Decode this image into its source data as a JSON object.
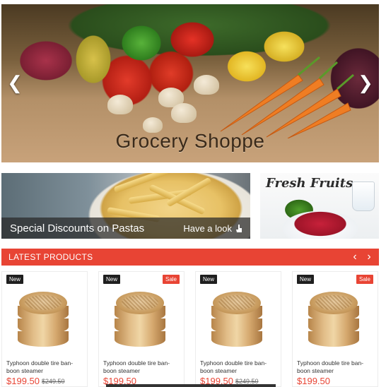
{
  "hero": {
    "title": "Grocery Shoppe",
    "prev_icon": "chevron-left-icon",
    "next_icon": "chevron-right-icon"
  },
  "banners": {
    "pasta": {
      "caption": "Special Discounts on Pastas",
      "link_label": "Have a look",
      "link_icon": "cursor-icon"
    },
    "fruits": {
      "title": "Fresh Fruits"
    }
  },
  "latest": {
    "label": "LATEST PRODUCTS",
    "prev_icon": "chevron-left-icon",
    "next_icon": "chevron-right-icon"
  },
  "products": [
    {
      "badge_new": "New",
      "badge_sale": "",
      "name": "Typhoon double tire ban-boon steamer",
      "price": "$199.50",
      "old_price": "$249.50"
    },
    {
      "badge_new": "New",
      "badge_sale": "Sale",
      "name": "Typhoon double tire ban-boon steamer",
      "price": "$199.50",
      "old_price": ""
    },
    {
      "badge_new": "New",
      "badge_sale": "",
      "name": "Typhoon double tire ban-boon steamer",
      "price": "$199.50",
      "old_price": "$249.50"
    },
    {
      "badge_new": "New",
      "badge_sale": "Sale",
      "name": "Typhoon double tire ban-boon steamer",
      "price": "$199.50",
      "old_price": ""
    }
  ],
  "colors": {
    "accent": "#e84434",
    "badge_new": "#1f1f1f"
  }
}
